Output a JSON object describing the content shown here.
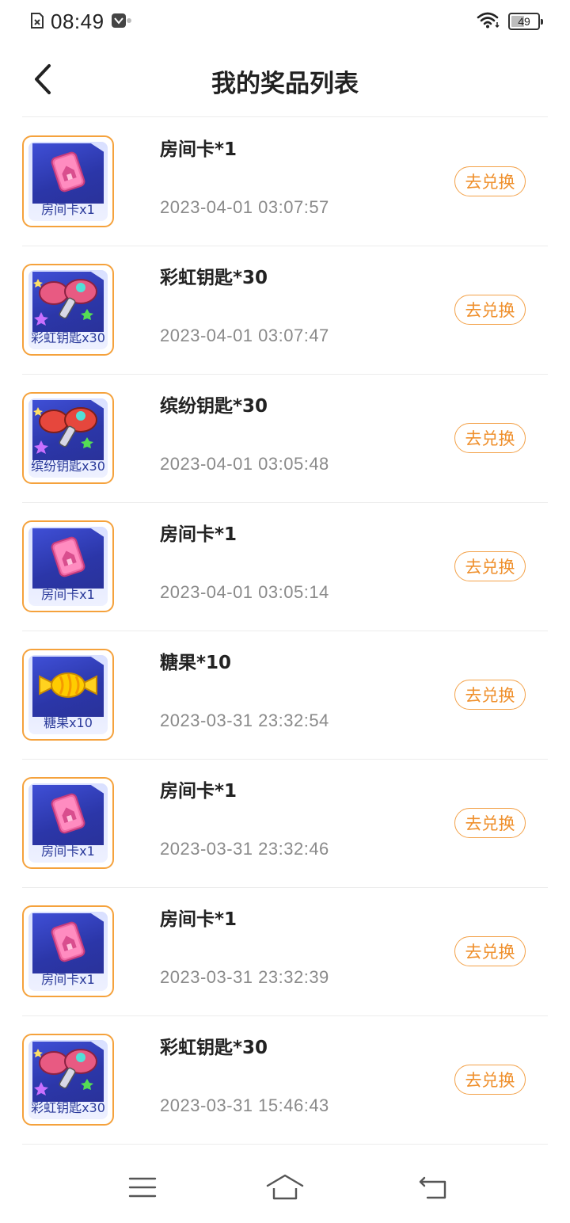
{
  "status_bar": {
    "time": "08:49",
    "battery_level": "49",
    "battery_fraction": 0.49
  },
  "header": {
    "title": "我的奖品列表"
  },
  "colors": {
    "accent": "#ef8f2b",
    "thumb_border": "#f5a23c",
    "thumb_bg": "#2b36a8"
  },
  "prizes": [
    {
      "icon": "room-card-icon",
      "thumb_label": "房间卡x1",
      "title": "房间卡*1",
      "time": "2023-04-01 03:07:57",
      "action": "去兑换"
    },
    {
      "icon": "rainbow-key-icon",
      "thumb_label": "彩虹钥匙x30",
      "title": "彩虹钥匙*30",
      "time": "2023-04-01 03:07:47",
      "action": "去兑换"
    },
    {
      "icon": "colorful-key-icon",
      "thumb_label": "缤纷钥匙x30",
      "title": "缤纷钥匙*30",
      "time": "2023-04-01 03:05:48",
      "action": "去兑换"
    },
    {
      "icon": "room-card-icon",
      "thumb_label": "房间卡x1",
      "title": "房间卡*1",
      "time": "2023-04-01 03:05:14",
      "action": "去兑换"
    },
    {
      "icon": "candy-icon",
      "thumb_label": "糖果x10",
      "title": "糖果*10",
      "time": "2023-03-31 23:32:54",
      "action": "去兑换"
    },
    {
      "icon": "room-card-icon",
      "thumb_label": "房间卡x1",
      "title": "房间卡*1",
      "time": "2023-03-31 23:32:46",
      "action": "去兑换"
    },
    {
      "icon": "room-card-icon",
      "thumb_label": "房间卡x1",
      "title": "房间卡*1",
      "time": "2023-03-31 23:32:39",
      "action": "去兑换"
    },
    {
      "icon": "rainbow-key-icon",
      "thumb_label": "彩虹钥匙x30",
      "title": "彩虹钥匙*30",
      "time": "2023-03-31 15:46:43",
      "action": "去兑换"
    }
  ],
  "bottom_nav": {
    "items": [
      {
        "icon": "menu-icon"
      },
      {
        "icon": "home-icon"
      },
      {
        "icon": "back-icon"
      }
    ]
  }
}
